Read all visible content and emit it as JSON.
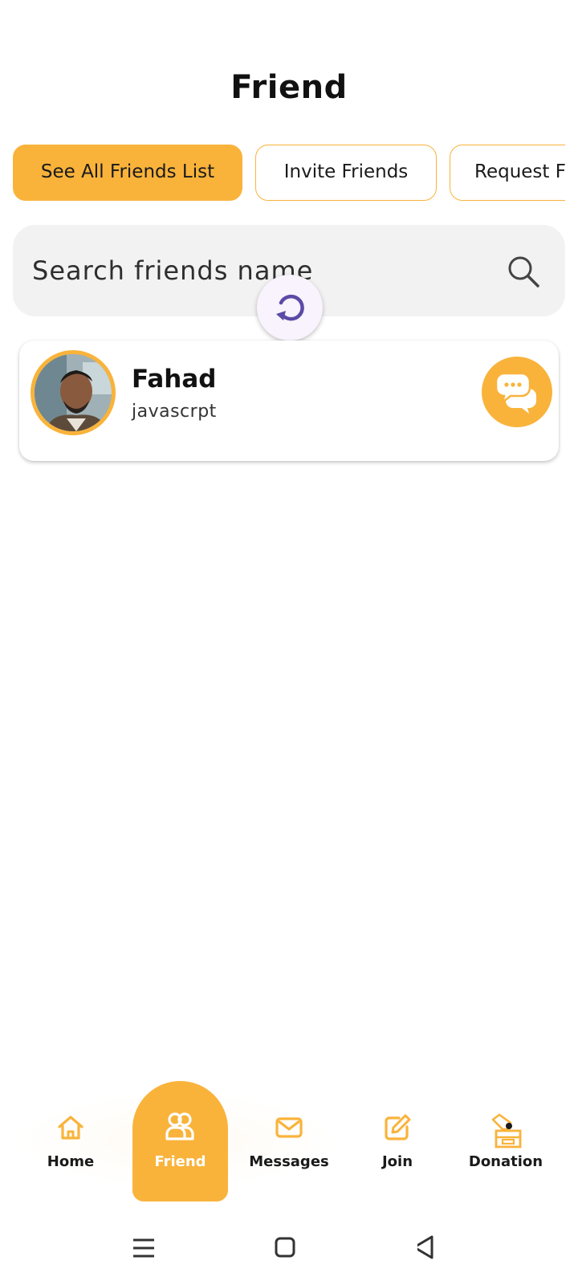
{
  "header": {
    "title": "Friend"
  },
  "tabs": [
    {
      "label": "See All Friends List",
      "active": true
    },
    {
      "label": "Invite Friends",
      "active": false
    },
    {
      "label": "Request F",
      "active": false
    }
  ],
  "search": {
    "placeholder": "Search friends name",
    "icon": "search-icon"
  },
  "friends": [
    {
      "name": "Fahad",
      "subtitle": "javascrpt",
      "action_icon": "chat-bubbles-icon"
    }
  ],
  "bottom_nav": {
    "items": [
      {
        "label": "Home",
        "icon": "home-icon"
      },
      {
        "label": "Friend",
        "icon": "friends-icon",
        "active": true
      },
      {
        "label": "Messages",
        "icon": "envelope-icon"
      },
      {
        "label": "Join",
        "icon": "edit-icon"
      },
      {
        "label": "Donation",
        "icon": "donation-box-icon"
      }
    ]
  },
  "system_nav": {
    "buttons": [
      "menu-icon",
      "home-square-icon",
      "back-triangle-icon"
    ]
  },
  "colors": {
    "accent": "#f9b33b",
    "refresh": "#5b4aa6",
    "search_bg": "#f2f2f2"
  }
}
